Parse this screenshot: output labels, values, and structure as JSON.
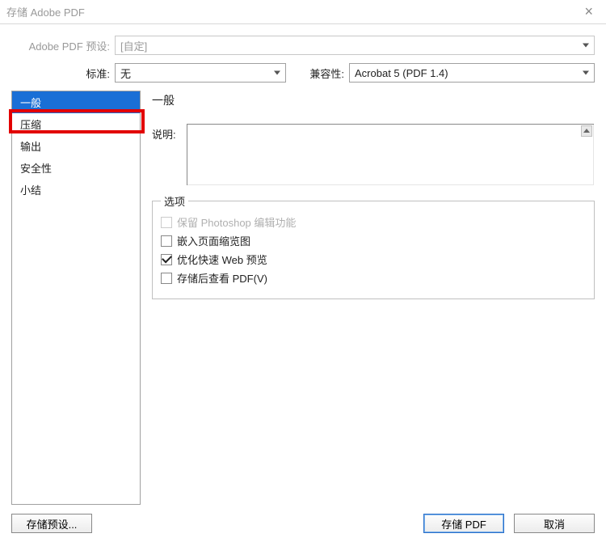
{
  "title": "存储 Adobe PDF",
  "preset": {
    "label": "Adobe PDF 预设:",
    "value": "[自定]"
  },
  "standard": {
    "label": "标准:",
    "value": "无"
  },
  "compat": {
    "label": "兼容性:",
    "value": "Acrobat 5 (PDF 1.4)"
  },
  "sidebar": {
    "items": [
      {
        "label": "一般"
      },
      {
        "label": "压缩"
      },
      {
        "label": "输出"
      },
      {
        "label": "安全性"
      },
      {
        "label": "小结"
      }
    ]
  },
  "right": {
    "heading": "一般",
    "desc_label": "说明:",
    "options_legend": "选项",
    "options": [
      {
        "label": "保留 Photoshop 编辑功能"
      },
      {
        "label": "嵌入页面缩览图"
      },
      {
        "label": "优化快速 Web 预览"
      },
      {
        "label": "存储后查看 PDF(V)"
      }
    ]
  },
  "buttons": {
    "save_preset": "存储预设...",
    "save_pdf": "存储 PDF",
    "cancel": "取消"
  }
}
